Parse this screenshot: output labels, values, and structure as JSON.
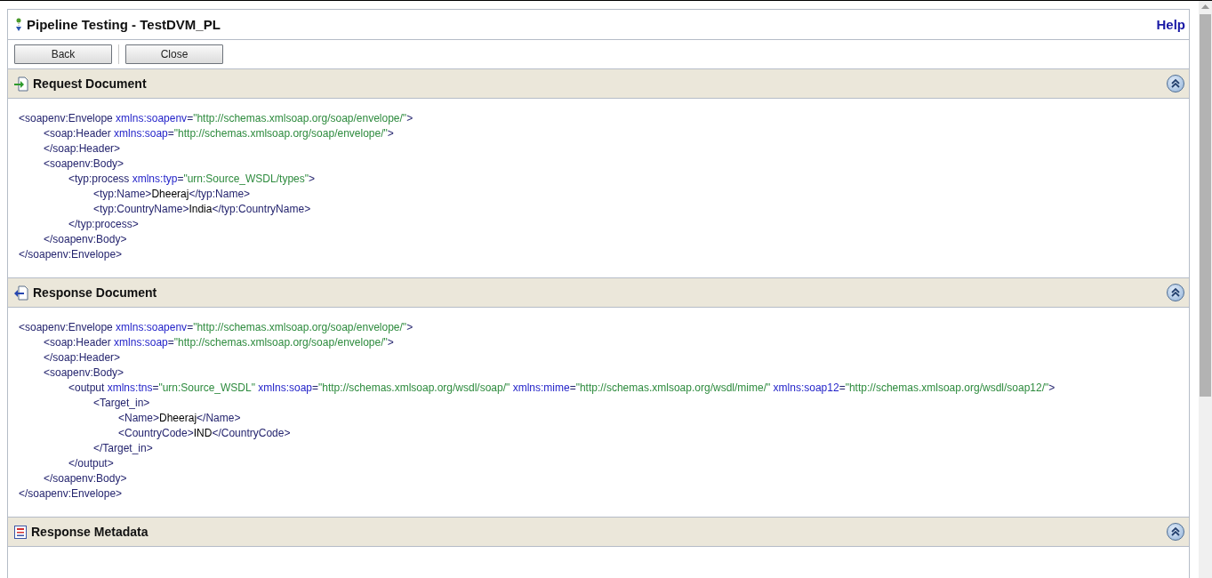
{
  "page": {
    "title": "Pipeline Testing - TestDVM_PL",
    "help": "Help"
  },
  "toolbar": {
    "buttons": [
      "Back",
      "Close"
    ]
  },
  "sections": [
    {
      "kind": "request",
      "title": "Request Document",
      "expanded": true,
      "document": [
        {
          "open": [
            {
              "kind": "tag",
              "text": "<soapenv:Envelope"
            },
            {
              "kind": "attr",
              "text": " xmlns:soapenv"
            },
            {
              "kind": "tag",
              "text": "="
            },
            {
              "kind": "val",
              "text": "\"http://schemas.xmlsoap.org/soap/envelope/\""
            },
            {
              "kind": "tag",
              "text": ">"
            }
          ],
          "close": [
            {
              "kind": "tag",
              "text": "</soapenv:Envelope>"
            }
          ],
          "children": [
            {
              "open": [
                {
                  "kind": "tag",
                  "text": "<soap:Header"
                },
                {
                  "kind": "attr",
                  "text": " xmlns:soap"
                },
                {
                  "kind": "tag",
                  "text": "="
                },
                {
                  "kind": "val",
                  "text": "\"http://schemas.xmlsoap.org/soap/envelope/\""
                },
                {
                  "kind": "tag",
                  "text": ">"
                }
              ],
              "close": [
                {
                  "kind": "tag",
                  "text": "</soap:Header>"
                }
              ]
            },
            {
              "open": [
                {
                  "kind": "tag",
                  "text": "<soapenv:Body>"
                }
              ],
              "close": [
                {
                  "kind": "tag",
                  "text": "</soapenv:Body>"
                }
              ],
              "children": [
                {
                  "open": [
                    {
                      "kind": "tag",
                      "text": "<typ:process"
                    },
                    {
                      "kind": "attr",
                      "text": " xmlns:typ"
                    },
                    {
                      "kind": "tag",
                      "text": "="
                    },
                    {
                      "kind": "val",
                      "text": "\"urn:Source_WSDL/types\""
                    },
                    {
                      "kind": "tag",
                      "text": ">"
                    }
                  ],
                  "close": [
                    {
                      "kind": "tag",
                      "text": "</typ:process>"
                    }
                  ],
                  "children": [
                    {
                      "open": [
                        {
                          "kind": "tag",
                          "text": "<typ:Name>"
                        },
                        {
                          "kind": "text",
                          "text": "Dheeraj"
                        },
                        {
                          "kind": "tag",
                          "text": "</typ:Name>"
                        }
                      ]
                    },
                    {
                      "open": [
                        {
                          "kind": "tag",
                          "text": "<typ:CountryName>"
                        },
                        {
                          "kind": "text",
                          "text": "India"
                        },
                        {
                          "kind": "tag",
                          "text": "</typ:CountryName>"
                        }
                      ]
                    }
                  ]
                }
              ]
            }
          ]
        }
      ]
    },
    {
      "kind": "response",
      "title": "Response Document",
      "expanded": true,
      "document": [
        {
          "open": [
            {
              "kind": "tag",
              "text": "<soapenv:Envelope"
            },
            {
              "kind": "attr",
              "text": " xmlns:soapenv"
            },
            {
              "kind": "tag",
              "text": "="
            },
            {
              "kind": "val",
              "text": "\"http://schemas.xmlsoap.org/soap/envelope/\""
            },
            {
              "kind": "tag",
              "text": ">"
            }
          ],
          "close": [
            {
              "kind": "tag",
              "text": "</soapenv:Envelope>"
            }
          ],
          "children": [
            {
              "open": [
                {
                  "kind": "tag",
                  "text": "<soap:Header"
                },
                {
                  "kind": "attr",
                  "text": " xmlns:soap"
                },
                {
                  "kind": "tag",
                  "text": "="
                },
                {
                  "kind": "val",
                  "text": "\"http://schemas.xmlsoap.org/soap/envelope/\""
                },
                {
                  "kind": "tag",
                  "text": ">"
                }
              ],
              "close": [
                {
                  "kind": "tag",
                  "text": "</soap:Header>"
                }
              ]
            },
            {
              "open": [
                {
                  "kind": "tag",
                  "text": "<soapenv:Body>"
                }
              ],
              "close": [
                {
                  "kind": "tag",
                  "text": "</soapenv:Body>"
                }
              ],
              "children": [
                {
                  "open": [
                    {
                      "kind": "tag",
                      "text": "<output"
                    },
                    {
                      "kind": "attr",
                      "text": " xmlns:tns"
                    },
                    {
                      "kind": "tag",
                      "text": "="
                    },
                    {
                      "kind": "val",
                      "text": "\"urn:Source_WSDL\""
                    },
                    {
                      "kind": "attr",
                      "text": " xmlns:soap"
                    },
                    {
                      "kind": "tag",
                      "text": "="
                    },
                    {
                      "kind": "val",
                      "text": "\"http://schemas.xmlsoap.org/wsdl/soap/\""
                    },
                    {
                      "kind": "attr",
                      "text": " xmlns:mime"
                    },
                    {
                      "kind": "tag",
                      "text": "="
                    },
                    {
                      "kind": "val",
                      "text": "\"http://schemas.xmlsoap.org/wsdl/mime/\""
                    },
                    {
                      "kind": "attr",
                      "text": " xmlns:soap12"
                    },
                    {
                      "kind": "tag",
                      "text": "="
                    },
                    {
                      "kind": "val",
                      "text": "\"http://schemas.xmlsoap.org/wsdl/soap12/\""
                    },
                    {
                      "kind": "tag",
                      "text": ">"
                    }
                  ],
                  "close": [
                    {
                      "kind": "tag",
                      "text": "</output>"
                    }
                  ],
                  "children": [
                    {
                      "open": [
                        {
                          "kind": "tag",
                          "text": "<Target_in>"
                        }
                      ],
                      "close": [
                        {
                          "kind": "tag",
                          "text": "</Target_in>"
                        }
                      ],
                      "children": [
                        {
                          "open": [
                            {
                              "kind": "tag",
                              "text": "<Name>"
                            },
                            {
                              "kind": "text",
                              "text": "Dheeraj"
                            },
                            {
                              "kind": "tag",
                              "text": "</Name>"
                            }
                          ]
                        },
                        {
                          "open": [
                            {
                              "kind": "tag",
                              "text": "<CountryCode>"
                            },
                            {
                              "kind": "text",
                              "text": "IND"
                            },
                            {
                              "kind": "tag",
                              "text": "</CountryCode>"
                            }
                          ]
                        }
                      ]
                    }
                  ]
                }
              ]
            }
          ]
        }
      ]
    },
    {
      "kind": "metadata",
      "title": "Response Metadata",
      "expanded": true
    }
  ]
}
